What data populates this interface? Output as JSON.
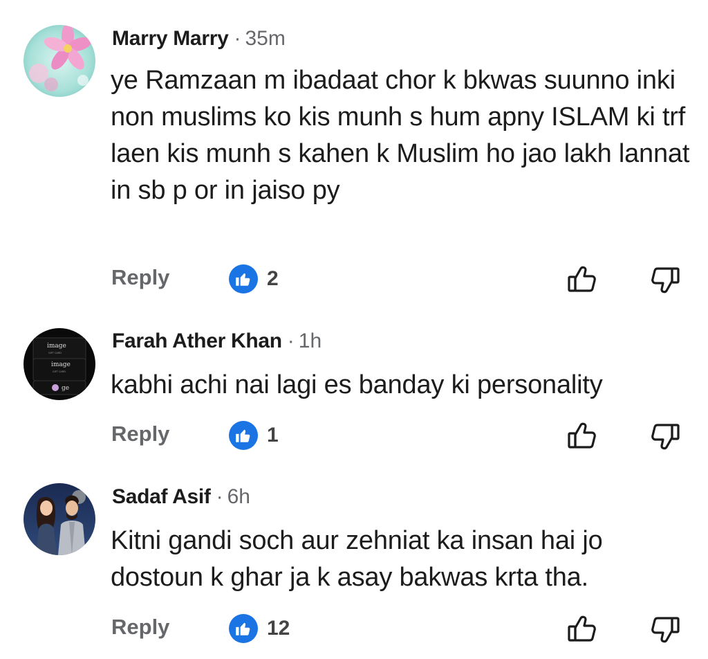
{
  "comments": [
    {
      "author": "Marry Marry",
      "separator": "·",
      "time": "35m",
      "text": "ye Ramzaan m ibadaat chor k bkwas suunno inki non muslims ko kis munh s hum apny ISLAM ki trf laen kis munh s kahen k Muslim ho jao lakh lannat in sb p or in jaiso py",
      "reply_label": "Reply",
      "like_count": "2",
      "avatar_icon": "flower-avatar-icon"
    },
    {
      "author": "Farah Ather Khan",
      "separator": "·",
      "time": "1h",
      "text": "kabhi achi nai lagi es banday ki personality",
      "reply_label": "Reply",
      "like_count": "1",
      "avatar_icon": "gift-card-avatar-icon",
      "avatar_text": [
        "image",
        "GIFT CARD",
        "image",
        "GIFT CARD",
        "ge"
      ]
    },
    {
      "author": "Sadaf Asif",
      "separator": "·",
      "time": "6h",
      "text": "Kitni gandi soch aur zehniat ka insan hai jo dostoun k ghar ja k asay bakwas krta tha.",
      "reply_label": "Reply",
      "like_count": "12",
      "avatar_icon": "couple-illustration-avatar-icon"
    }
  ],
  "colors": {
    "like_blue": "#1b74e4",
    "meta_gray": "#65676b",
    "text_dark": "#1c1c1c"
  }
}
